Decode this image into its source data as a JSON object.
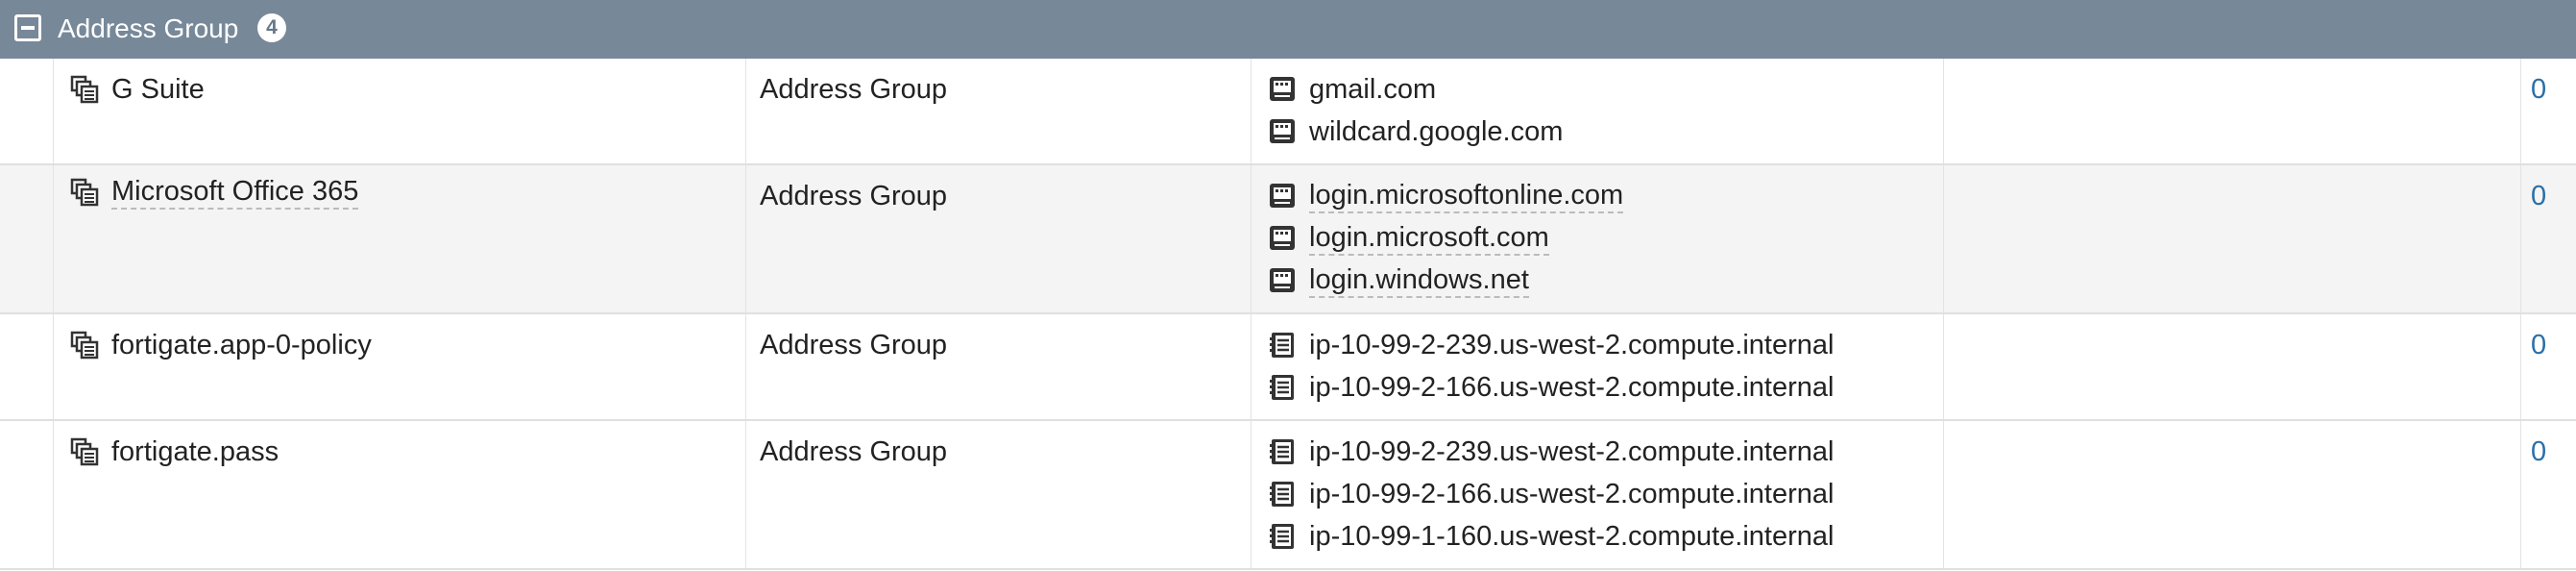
{
  "group": {
    "title": "Address Group",
    "count": "4"
  },
  "rows": [
    {
      "name": "G Suite",
      "name_dotted": false,
      "type": "Address Group",
      "members": [
        {
          "label": "gmail.com",
          "icon": "fqdn-icon",
          "dotted": false
        },
        {
          "label": "wildcard.google.com",
          "icon": "fqdn-icon",
          "dotted": false
        }
      ],
      "ref": "0"
    },
    {
      "name": "Microsoft Office 365",
      "name_dotted": true,
      "type": "Address Group",
      "members": [
        {
          "label": "login.microsoftonline.com",
          "icon": "fqdn-icon",
          "dotted": true
        },
        {
          "label": "login.microsoft.com",
          "icon": "fqdn-icon",
          "dotted": true
        },
        {
          "label": "login.windows.net",
          "icon": "fqdn-icon",
          "dotted": true
        }
      ],
      "ref": "0"
    },
    {
      "name": "fortigate.app-0-policy",
      "name_dotted": false,
      "type": "Address Group",
      "members": [
        {
          "label": "ip-10-99-2-239.us-west-2.compute.internal",
          "icon": "address-list-icon",
          "dotted": false
        },
        {
          "label": "ip-10-99-2-166.us-west-2.compute.internal",
          "icon": "address-list-icon",
          "dotted": false
        }
      ],
      "ref": "0"
    },
    {
      "name": "fortigate.pass",
      "name_dotted": false,
      "type": "Address Group",
      "members": [
        {
          "label": "ip-10-99-2-239.us-west-2.compute.internal",
          "icon": "address-list-icon",
          "dotted": false
        },
        {
          "label": "ip-10-99-2-166.us-west-2.compute.internal",
          "icon": "address-list-icon",
          "dotted": false
        },
        {
          "label": "ip-10-99-1-160.us-west-2.compute.internal",
          "icon": "address-list-icon",
          "dotted": false
        }
      ],
      "ref": "0"
    }
  ]
}
